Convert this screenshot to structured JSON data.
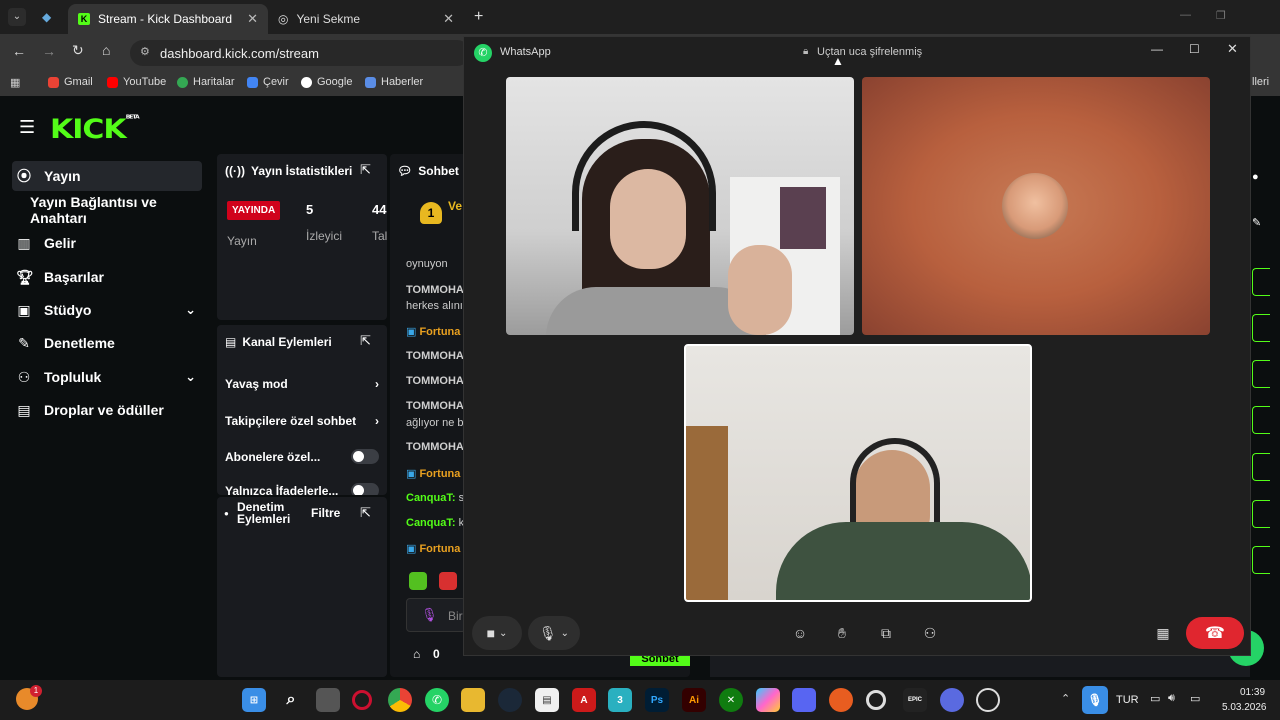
{
  "browser": {
    "tabs": [
      {
        "label": "Stream - Kick Dashboard",
        "close": "✕"
      },
      {
        "label": "Yeni Sekme",
        "close": "✕"
      }
    ],
    "new_tab": "+",
    "url": "dashboard.kick.com/stream",
    "bookmarks": [
      "Gmail",
      "YouTube",
      "Haritalar",
      "Çevir",
      "Google",
      "Haberler"
    ],
    "all_bookmarks_fragment": "lleri"
  },
  "kick": {
    "logo": "KICK",
    "logo_badge": "BETA",
    "nav": [
      {
        "label": "Yayın",
        "icon": "broadcast-icon"
      },
      {
        "label": "Yayın Bağlantısı ve Anahtarı",
        "icon": ""
      },
      {
        "label": "Gelir",
        "icon": "chart-icon"
      },
      {
        "label": "Başarılar",
        "icon": "trophy-icon"
      },
      {
        "label": "Stüdyo",
        "icon": "studio-icon"
      },
      {
        "label": "Denetleme",
        "icon": "wrench-icon"
      },
      {
        "label": "Topluluk",
        "icon": "people-icon"
      },
      {
        "label": "Droplar ve ödüller",
        "icon": "gift-icon"
      }
    ],
    "stats": {
      "title": "Yayın İstatistikleri",
      "live": "YAYINDA",
      "live_label": "Yayın",
      "viewers": "5",
      "viewers_label": "İzleyici",
      "third": "44",
      "third_label": "Tal"
    },
    "channel_actions": {
      "title": "Kanal Eylemleri",
      "items": [
        "Yavaş mod",
        "Takipçilere özel sohbet",
        "Abonelere özel...",
        "Yalnızca İfadelerle..."
      ]
    },
    "moderation": {
      "title_line1": "Denetim",
      "title_line2": "Eylemleri",
      "filter": "Filtre"
    },
    "chat": {
      "title": "Sohbet",
      "top_user": "Ve",
      "top_rank": "1",
      "lines": [
        {
          "user": "",
          "text": "oynuyon"
        },
        {
          "user": "TOMMOHA",
          "text": ""
        },
        {
          "user": "",
          "text": "herkes alını"
        },
        {
          "user": "Fortuna",
          "text": ""
        },
        {
          "user": "TOMMOHA",
          "text": ""
        },
        {
          "user": "TOMMOHA",
          "text": ""
        },
        {
          "user": "TOMMOHA",
          "text": ""
        },
        {
          "user": "",
          "text": "ağlıyor ne b"
        },
        {
          "user": "TOMMOHA",
          "text": ""
        },
        {
          "user": "Fortuna",
          "text": ""
        },
        {
          "user": "CanquaT:",
          "text": "s"
        },
        {
          "user": "CanquaT:",
          "text": "k"
        },
        {
          "user": "Fortuna",
          "text": ""
        }
      ],
      "input_placeholder": "Bir",
      "points": "0",
      "send": "Sohbet"
    }
  },
  "whatsapp": {
    "title": "WhatsApp",
    "encryption": "Uçtan uca şifrelenmiş"
  },
  "taskbar": {
    "lang": "TUR",
    "time": "01:39",
    "date": "5.03.2026",
    "notification_badge": "1"
  },
  "colors": {
    "kick_green": "#53fc18",
    "live_red": "#d0021b",
    "wa_green": "#25d366",
    "end_call": "#e0262f"
  }
}
